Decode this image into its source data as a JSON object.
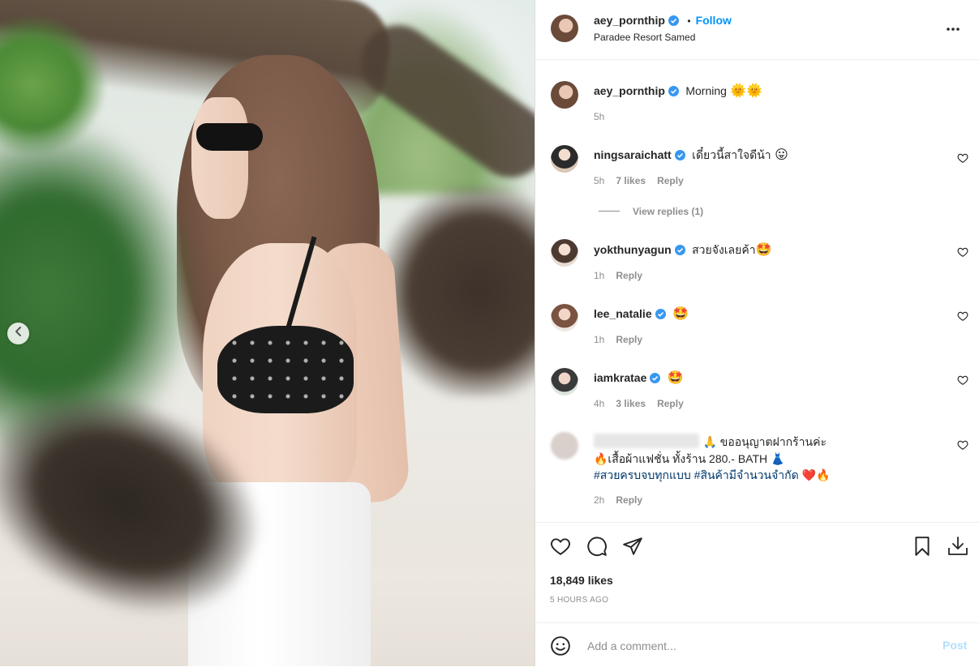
{
  "post": {
    "owner": {
      "username": "aey_pornthip",
      "follow_label": "Follow",
      "separator": "•",
      "location": "Paradee Resort Samed",
      "more_label": "•••"
    },
    "caption": {
      "username": "aey_pornthip",
      "text": "Morning",
      "emoji": "🌞🌞",
      "time": "5h"
    },
    "comments": [
      {
        "username": "ningsaraichatt",
        "text": "เดี๋ยวนี้สาใจดีน้า",
        "emoji": "😛",
        "time": "5h",
        "likes": "7 likes",
        "reply": "Reply",
        "view_replies": "View replies (1)"
      },
      {
        "username": "yokthunyagun",
        "text": "สวยจังเลยค้า",
        "emoji": "🤩",
        "time": "1h",
        "reply": "Reply"
      },
      {
        "username": "lee_natalie",
        "text": "",
        "emoji": "🤩",
        "time": "1h",
        "reply": "Reply"
      },
      {
        "username": "iamkratae",
        "text": "",
        "emoji": "🤩",
        "time": "4h",
        "likes": "3 likes",
        "reply": "Reply"
      },
      {
        "username": "",
        "line1": "🙏 ขออนุญาตฝากร้านค่ะ",
        "line2": "🔥เสื้อผ้าแฟชั่น ทั้งร้าน 280.- BATH 👗",
        "line3_tag1": "#สวยครบจบทุกแบบ",
        "line3_tag2": "#สินค้ามีจำนวนจำกัด",
        "line3_emoji": "❤️🔥",
        "time": "2h",
        "reply": "Reply"
      }
    ],
    "likes_count": "18,849 likes",
    "posted_ago": "5 HOURS AGO",
    "comment_box": {
      "placeholder": "Add a comment...",
      "post_label": "Post"
    }
  },
  "colors": {
    "verified": "#3897f0",
    "follow": "#0095f6",
    "post_disabled": "#b2dffc"
  },
  "icons": [
    "chevron-left-icon",
    "verified-badge-icon",
    "more-icon",
    "heart-icon",
    "comment-icon",
    "share-icon",
    "bookmark-icon",
    "download-icon",
    "emoji-icon"
  ]
}
